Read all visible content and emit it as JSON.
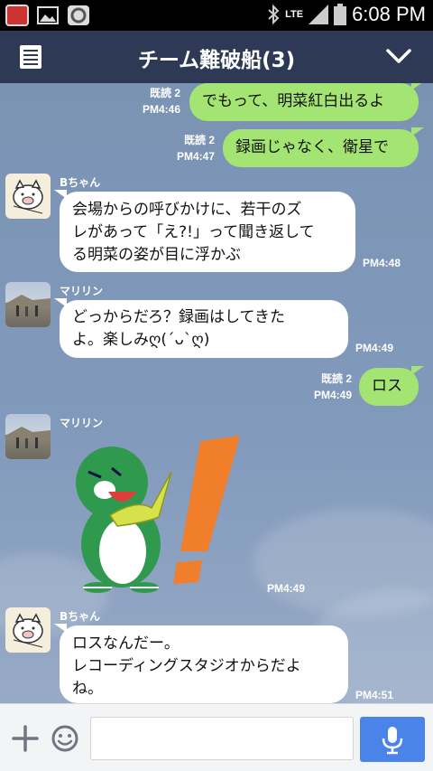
{
  "status_bar": {
    "time": "6:08 PM",
    "network": "LTE"
  },
  "header": {
    "title": "チーム難破船(3)"
  },
  "messages": [
    {
      "type": "sent",
      "read": "既読 2",
      "time": "PM4:46",
      "text": "でもって、明菜紅白出るよ"
    },
    {
      "type": "sent",
      "read": "既読 2",
      "time": "PM4:47",
      "text": "録画じゃなく、衛星で"
    },
    {
      "type": "received",
      "sender": "Bちゃん",
      "time": "PM4:48",
      "lines": [
        "会場からの呼びかけに、若干のズ",
        "レがあって「え?!」って聞き返して",
        "る明菜の姿が目に浮かぶ"
      ]
    },
    {
      "type": "received",
      "sender": "マリリン",
      "time": "PM4:49",
      "lines": [
        "どっからだろ？録画はしてきた",
        "よ。楽しみღ(´ᴗ`ღ)"
      ]
    },
    {
      "type": "sent",
      "read": "既読 2",
      "time": "PM4:49",
      "text": "ロス"
    },
    {
      "type": "sticker",
      "sender": "マリリン",
      "time": "PM4:49"
    },
    {
      "type": "received",
      "sender": "Bちゃん",
      "time": "PM4:51",
      "lines": [
        "ロスなんだー。",
        "レコーディングスタジオからだよ",
        "ね。"
      ]
    }
  ],
  "input": {
    "placeholder": ""
  },
  "colors": {
    "header": "#2e3a55",
    "sent_bubble": "#a3e472",
    "received_bubble": "#ffffff",
    "send_button": "#4b84e8"
  },
  "icons": [
    "menu-icon",
    "chevron-down-icon",
    "plus-icon",
    "emoji-icon",
    "mic-icon",
    "bluetooth-icon",
    "signal-icon",
    "battery-icon"
  ]
}
